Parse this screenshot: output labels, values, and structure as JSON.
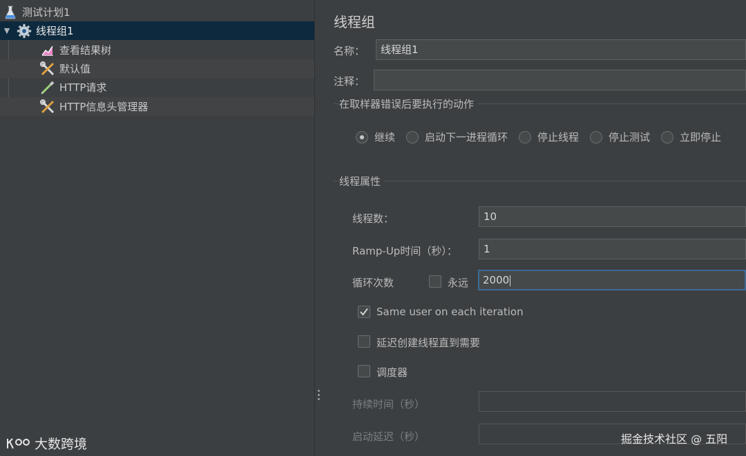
{
  "tree": {
    "items": [
      {
        "label": "测试计划1",
        "icon": "flask-icon"
      },
      {
        "label": "线程组1",
        "icon": "gear-icon"
      },
      {
        "label": "查看结果树",
        "icon": "chart-icon"
      },
      {
        "label": "默认值",
        "icon": "tools-icon"
      },
      {
        "label": "HTTP请求",
        "icon": "pipette-icon"
      },
      {
        "label": "HTTP信息头管理器",
        "icon": "tools-icon"
      }
    ]
  },
  "panel": {
    "title": "线程组",
    "name_label": "名称：",
    "name_value": "线程组1",
    "comment_label": "注释：",
    "comment_value": "",
    "error_section": "在取样器错误后要执行的动作",
    "actions": [
      {
        "label": "继续",
        "selected": true
      },
      {
        "label": "启动下一进程循环",
        "selected": false
      },
      {
        "label": "停止线程",
        "selected": false
      },
      {
        "label": "停止测试",
        "selected": false
      },
      {
        "label": "立即停止",
        "selected": false
      }
    ],
    "props_section": "线程属性",
    "threads_label": "线程数：",
    "threads_value": "10",
    "rampup_label": "Ramp-Up时间（秒）：",
    "rampup_value": "1",
    "loop_label": "循环次数",
    "forever_label": "永远",
    "forever_checked": false,
    "loop_value": "2000",
    "same_user_label": "Same user on each iteration",
    "same_user_checked": true,
    "delay_label": "延迟创建线程直到需要",
    "delay_checked": false,
    "scheduler_label": "调度器",
    "scheduler_checked": false,
    "duration_label": "持续时间（秒）",
    "duration_value": "",
    "startup_label": "启动延迟（秒）",
    "startup_value": ""
  },
  "watermarks": {
    "left": "大数跨境",
    "right": "掘金技术社区 @ 五阳"
  },
  "colors": {
    "background": "#3c3f41",
    "selection": "#0d293e",
    "focus_border": "#3d6a97"
  }
}
